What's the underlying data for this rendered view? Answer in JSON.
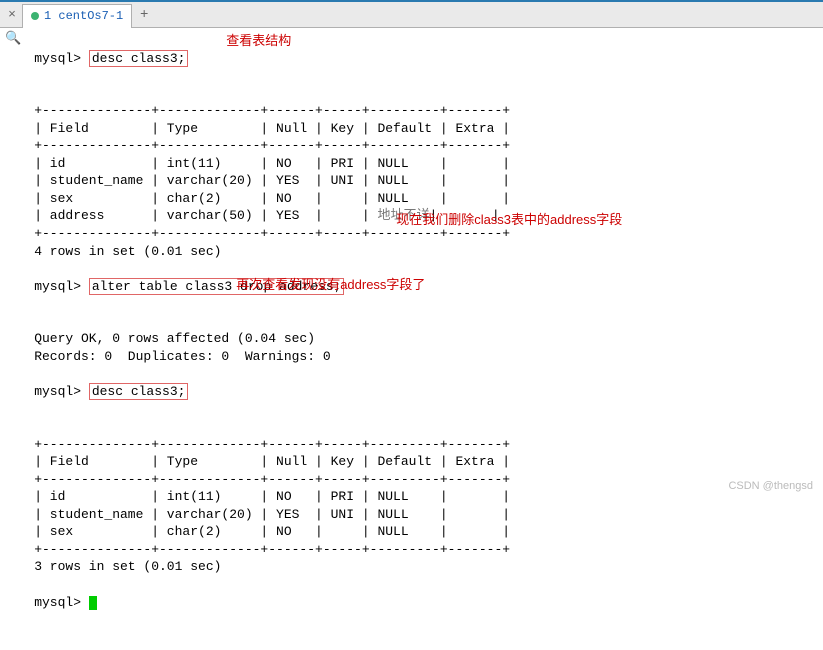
{
  "tab": {
    "close_all": "×",
    "label": "1 centOs7-1",
    "add": "+"
  },
  "search_icon": "🔍",
  "prompt": "mysql>",
  "cmd1": "desc class3;",
  "ann1": "查看表结构",
  "table1": {
    "border_top": "+--------------+-------------+------+-----+---------+-------+",
    "header": "| Field        | Type        | Null | Key | Default | Extra |",
    "rows": [
      "| id           | int(11)     | NO   | PRI | NULL    |       |",
      "| student_name | varchar(20) | YES  | UNI | NULL    |       |",
      "| sex          | char(2)     | NO   |     | NULL    |       |",
      "| address      | varchar(50) | YES  |     |"
    ],
    "addr_default": "地址不详",
    "addr_tail": "|       |"
  },
  "result1": "4 rows in set (0.01 sec)",
  "cmd2": "alter table class3 drop address;",
  "ann2": "现在我们删除class3表中的address字段",
  "result2a": "Query OK, 0 rows affected (0.04 sec)",
  "result2b": "Records: 0  Duplicates: 0  Warnings: 0",
  "cmd3": "desc class3;",
  "ann3": "再次查看发现没有address字段了",
  "table2": {
    "border_top": "+--------------+-------------+------+-----+---------+-------+",
    "header": "| Field        | Type        | Null | Key | Default | Extra |",
    "rows": [
      "| id           | int(11)     | NO   | PRI | NULL    |       |",
      "| student_name | varchar(20) | YES  | UNI | NULL    |       |",
      "| sex          | char(2)     | NO   |     | NULL    |       |"
    ]
  },
  "result3": "3 rows in set (0.01 sec)",
  "watermark": "CSDN @thengsd"
}
